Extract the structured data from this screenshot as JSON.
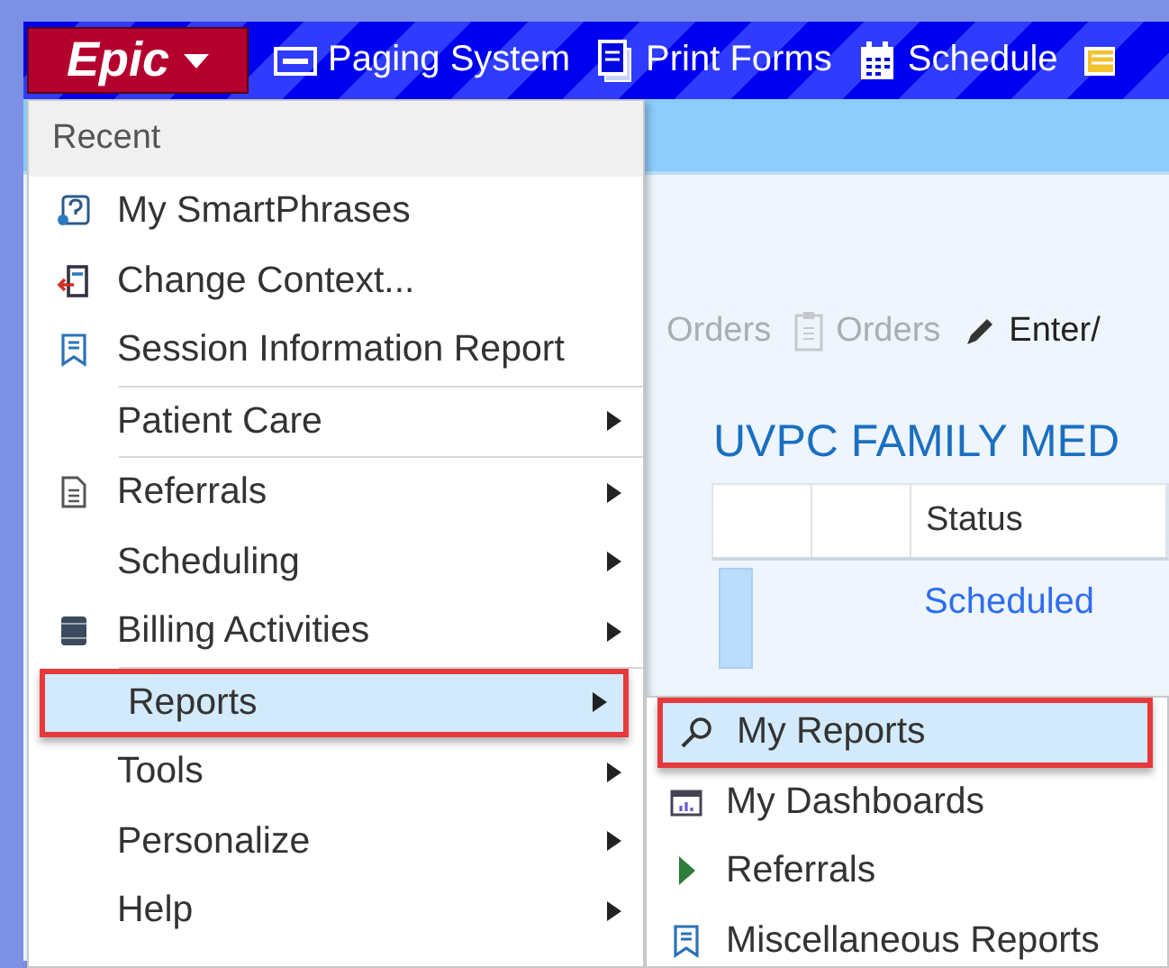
{
  "top_bar": {
    "logo": "Epic",
    "items": [
      {
        "label": "Paging System"
      },
      {
        "label": "Print Forms"
      },
      {
        "label": "Schedule"
      }
    ]
  },
  "toolbar": [
    {
      "label": "Orders",
      "disabled": true
    },
    {
      "label": "Orders",
      "disabled": true
    },
    {
      "label": "Enter/",
      "disabled": false
    }
  ],
  "department_title": "UVPC FAMILY MED",
  "table": {
    "columns": [
      "",
      "",
      "Status"
    ],
    "rows": [
      {
        "status": "Scheduled"
      }
    ]
  },
  "menu": {
    "header": "Recent",
    "items": [
      {
        "kind": "item",
        "label": "My SmartPhrases",
        "submenu": false,
        "selected": false
      },
      {
        "kind": "item",
        "label": "Change Context...",
        "submenu": false,
        "selected": false
      },
      {
        "kind": "item",
        "label": "Session Information Report",
        "submenu": false,
        "selected": false
      },
      {
        "kind": "separator"
      },
      {
        "kind": "item",
        "label": "Patient Care",
        "submenu": true,
        "selected": false
      },
      {
        "kind": "separator"
      },
      {
        "kind": "item",
        "label": "Referrals",
        "submenu": true,
        "selected": false
      },
      {
        "kind": "item",
        "label": "Scheduling",
        "submenu": true,
        "selected": false
      },
      {
        "kind": "item",
        "label": "Billing Activities",
        "submenu": true,
        "selected": false
      },
      {
        "kind": "separator"
      },
      {
        "kind": "item",
        "label": "Reports",
        "submenu": true,
        "selected": true
      },
      {
        "kind": "item",
        "label": "Tools",
        "submenu": true,
        "selected": false
      },
      {
        "kind": "item",
        "label": "Personalize",
        "submenu": true,
        "selected": false
      },
      {
        "kind": "item",
        "label": "Help",
        "submenu": true,
        "selected": false
      }
    ]
  },
  "submenu": {
    "items": [
      {
        "label": "My Reports",
        "selected": true
      },
      {
        "label": "My Dashboards",
        "selected": false
      },
      {
        "label": "Referrals",
        "selected": false
      },
      {
        "label": "Miscellaneous Reports",
        "selected": false
      }
    ]
  }
}
